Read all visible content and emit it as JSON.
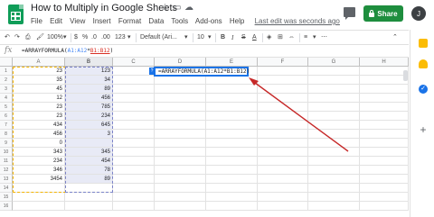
{
  "header": {
    "title": "How to Multiply in Google Sheets",
    "menu": [
      "File",
      "Edit",
      "View",
      "Insert",
      "Format",
      "Data",
      "Tools",
      "Add-ons",
      "Help"
    ],
    "last_edit": "Last edit was seconds ago",
    "share_label": "Share",
    "avatar_initial": "J"
  },
  "toolbar": {
    "zoom": "100%",
    "currency": "$",
    "percent": "%",
    "decimal_less": ".0",
    "decimal_more": ".00",
    "more_formats": "123",
    "font": "Default (Ari...",
    "font_size": "10",
    "bold": "B",
    "italic": "I",
    "strike": "S",
    "text_color": "A"
  },
  "formula_bar": {
    "fx": "fx",
    "prefix": "=ARRAYFORMULA(",
    "ref1": "A1:A12",
    "op": "*",
    "ref2": "B1:B12",
    "suffix": ")"
  },
  "grid": {
    "columns": [
      "A",
      "B",
      "C",
      "D",
      "E",
      "F",
      "G",
      "H"
    ],
    "rows": [
      "1",
      "2",
      "3",
      "4",
      "5",
      "6",
      "7",
      "8",
      "9",
      "10",
      "11",
      "12",
      "13",
      "14",
      "15",
      "16"
    ],
    "col_a": [
      "23",
      "35",
      "45",
      "12",
      "23",
      "23",
      "434",
      "456",
      "0",
      "343",
      "234",
      "346",
      "3454"
    ],
    "col_b": [
      "123",
      "34",
      "89",
      "456",
      "785",
      "234",
      "645",
      "3",
      "",
      "345",
      "454",
      "78",
      "89"
    ],
    "active_cell_formula": "=ARRAYFORMULA(A1:A12*B1:B12)",
    "active_help": "?"
  },
  "colors": {
    "accent": "#1a73e8",
    "share_green": "#1e8e3e",
    "arrow_red": "#c62828",
    "range_a": "#f4b400",
    "range_b": "#7b83c9"
  },
  "side_panel": {
    "icons": [
      "calendar-icon",
      "keep-icon",
      "tasks-icon",
      "add-icon"
    ],
    "tasks_check": "✓",
    "plus": "+"
  }
}
